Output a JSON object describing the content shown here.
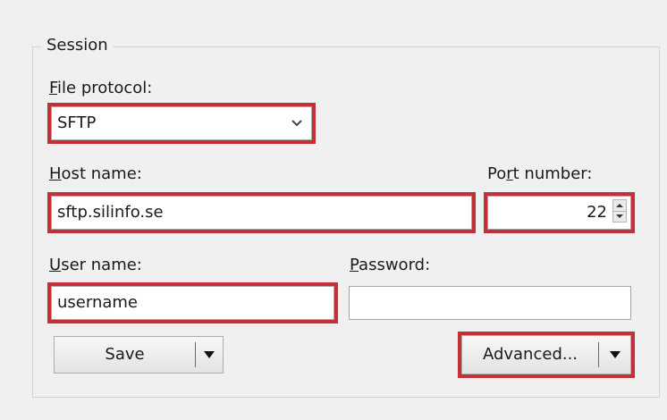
{
  "session": {
    "title": "Session",
    "file_protocol": {
      "label": "File protocol:",
      "accesskey": "F",
      "rest": "ile protocol:",
      "value": "SFTP"
    },
    "host_name": {
      "label": "Host name:",
      "accesskey": "H",
      "rest": "ost name:",
      "value": "sftp.silinfo.se"
    },
    "port_number": {
      "label": "Port number:",
      "pre": "Po",
      "accesskey": "r",
      "rest": "t number:",
      "value": "22"
    },
    "user_name": {
      "label": "User name:",
      "accesskey": "U",
      "rest": "ser name:",
      "value": "username"
    },
    "password": {
      "label": "Password:",
      "accesskey": "P",
      "rest": "assword:",
      "value": ""
    },
    "buttons": {
      "save": "Save",
      "advanced": "Advanced..."
    }
  },
  "icons": {
    "dropdown": "chevron-down-icon",
    "spin_up": "triangle-up-icon",
    "spin_down": "triangle-down-icon",
    "split_drop": "triangle-down-icon"
  },
  "colors": {
    "highlight": "#c3303a",
    "background": "#f0f0f0",
    "field": "#ffffff"
  }
}
